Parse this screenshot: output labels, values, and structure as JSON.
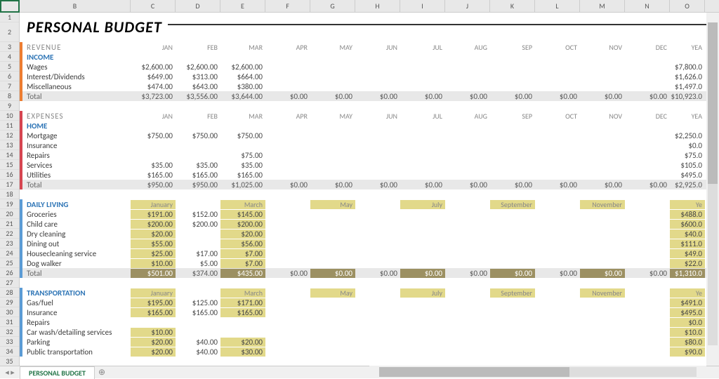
{
  "title": "PERSONAL BUDGET",
  "tab": "PERSONAL BUDGET",
  "cols": [
    "B",
    "C",
    "D",
    "E",
    "F",
    "G",
    "H",
    "I",
    "J",
    "K",
    "L",
    "M",
    "N",
    "O"
  ],
  "rownums": [
    1,
    2,
    3,
    4,
    5,
    6,
    7,
    8,
    9,
    10,
    11,
    12,
    13,
    14,
    15,
    16,
    17,
    18,
    19,
    20,
    21,
    22,
    23,
    24,
    25,
    26,
    27,
    28,
    29,
    30,
    31,
    32,
    33,
    34,
    35
  ],
  "months": [
    "JAN",
    "FEB",
    "MAR",
    "APR",
    "MAY",
    "JUN",
    "JUL",
    "AUG",
    "SEP",
    "OCT",
    "NOV",
    "DEC",
    "YEA"
  ],
  "months2": [
    "January",
    "",
    "March",
    "",
    "May",
    "",
    "July",
    "",
    "September",
    "",
    "November",
    "",
    "Ye"
  ],
  "revenue": {
    "label": "REVENUE",
    "cat": "INCOME",
    "rows": [
      {
        "name": "Wages",
        "v": [
          "$2,600.00",
          "$2,600.00",
          "$2,600.00",
          "",
          "",
          "",
          "",
          "",
          "",
          "",
          "",
          "",
          "$7,800.0"
        ]
      },
      {
        "name": "Interest/Dividends",
        "v": [
          "$649.00",
          "$313.00",
          "$664.00",
          "",
          "",
          "",
          "",
          "",
          "",
          "",
          "",
          "",
          "$1,626.0"
        ]
      },
      {
        "name": "Miscellaneous",
        "v": [
          "$474.00",
          "$643.00",
          "$380.00",
          "",
          "",
          "",
          "",
          "",
          "",
          "",
          "",
          "",
          "$1,497.0"
        ]
      }
    ],
    "total": {
      "name": "Total",
      "v": [
        "$3,723.00",
        "$3,556.00",
        "$3,644.00",
        "$0.00",
        "$0.00",
        "$0.00",
        "$0.00",
        "$0.00",
        "$0.00",
        "$0.00",
        "$0.00",
        "$0.00",
        "$10,923.0"
      ]
    }
  },
  "expenses": {
    "label": "EXPENSES",
    "cat": "HOME",
    "rows": [
      {
        "name": "Mortgage",
        "v": [
          "$750.00",
          "$750.00",
          "$750.00",
          "",
          "",
          "",
          "",
          "",
          "",
          "",
          "",
          "",
          "$2,250.0"
        ]
      },
      {
        "name": "Insurance",
        "v": [
          "",
          "",
          "",
          "",
          "",
          "",
          "",
          "",
          "",
          "",
          "",
          "",
          "$0.0"
        ]
      },
      {
        "name": "Repairs",
        "v": [
          "",
          "",
          "$75.00",
          "",
          "",
          "",
          "",
          "",
          "",
          "",
          "",
          "",
          "$75.0"
        ]
      },
      {
        "name": "Services",
        "v": [
          "$35.00",
          "$35.00",
          "$35.00",
          "",
          "",
          "",
          "",
          "",
          "",
          "",
          "",
          "",
          "$105.0"
        ]
      },
      {
        "name": "Utilities",
        "v": [
          "$165.00",
          "$165.00",
          "$165.00",
          "",
          "",
          "",
          "",
          "",
          "",
          "",
          "",
          "",
          "$495.0"
        ]
      }
    ],
    "total": {
      "name": "Total",
      "v": [
        "$950.00",
        "$950.00",
        "$1,025.00",
        "$0.00",
        "$0.00",
        "$0.00",
        "$0.00",
        "$0.00",
        "$0.00",
        "$0.00",
        "$0.00",
        "$0.00",
        "$2,925.0"
      ]
    }
  },
  "daily": {
    "cat": "DAILY LIVING",
    "rows": [
      {
        "name": "Groceries",
        "v": [
          "$191.00",
          "$152.00",
          "$145.00",
          "",
          "",
          "",
          "",
          "",
          "",
          "",
          "",
          "",
          "$488.0"
        ]
      },
      {
        "name": "Child care",
        "v": [
          "$200.00",
          "$200.00",
          "$200.00",
          "",
          "",
          "",
          "",
          "",
          "",
          "",
          "",
          "",
          "$600.0"
        ]
      },
      {
        "name": "Dry cleaning",
        "v": [
          "$20.00",
          "",
          "$20.00",
          "",
          "",
          "",
          "",
          "",
          "",
          "",
          "",
          "",
          "$40.0"
        ]
      },
      {
        "name": "Dining out",
        "v": [
          "$55.00",
          "",
          "$56.00",
          "",
          "",
          "",
          "",
          "",
          "",
          "",
          "",
          "",
          "$111.0"
        ]
      },
      {
        "name": "Housecleaning service",
        "v": [
          "$25.00",
          "$17.00",
          "$7.00",
          "",
          "",
          "",
          "",
          "",
          "",
          "",
          "",
          "",
          "$49.0"
        ]
      },
      {
        "name": "Dog walker",
        "v": [
          "$10.00",
          "$5.00",
          "$7.00",
          "",
          "",
          "",
          "",
          "",
          "",
          "",
          "",
          "",
          "$22.0"
        ]
      }
    ],
    "total": {
      "name": "Total",
      "v": [
        "$501.00",
        "$374.00",
        "$435.00",
        "$0.00",
        "$0.00",
        "$0.00",
        "$0.00",
        "$0.00",
        "$0.00",
        "$0.00",
        "$0.00",
        "$0.00",
        "$1,310.0"
      ]
    }
  },
  "transport": {
    "cat": "TRANSPORTATION",
    "rows": [
      {
        "name": "Gas/fuel",
        "v": [
          "$195.00",
          "$125.00",
          "$171.00",
          "",
          "",
          "",
          "",
          "",
          "",
          "",
          "",
          "",
          "$491.0"
        ]
      },
      {
        "name": "Insurance",
        "v": [
          "$165.00",
          "$165.00",
          "$165.00",
          "",
          "",
          "",
          "",
          "",
          "",
          "",
          "",
          "",
          "$495.0"
        ]
      },
      {
        "name": "Repairs",
        "v": [
          "",
          "",
          "",
          "",
          "",
          "",
          "",
          "",
          "",
          "",
          "",
          "",
          "$0.0"
        ]
      },
      {
        "name": "Car wash/detailing services",
        "v": [
          "$10.00",
          "",
          "",
          "",
          "",
          "",
          "",
          "",
          "",
          "",
          "",
          "",
          "$10.0"
        ]
      },
      {
        "name": "Parking",
        "v": [
          "$20.00",
          "$40.00",
          "$20.00",
          "",
          "",
          "",
          "",
          "",
          "",
          "",
          "",
          "",
          "$80.0"
        ]
      },
      {
        "name": "Public transportation",
        "v": [
          "$20.00",
          "$40.00",
          "$30.00",
          "",
          "",
          "",
          "",
          "",
          "",
          "",
          "",
          "",
          "$90.0"
        ]
      }
    ]
  }
}
